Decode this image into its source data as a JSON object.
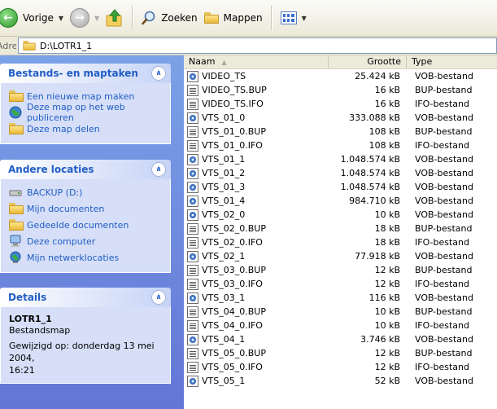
{
  "toolbar": {
    "back_label": "Vorige",
    "search_label": "Zoeken",
    "folders_label": "Mappen"
  },
  "address": {
    "label": "Adres",
    "path": "D:\\LOTR1_1"
  },
  "taskpane": {
    "file_tasks": {
      "title": "Bestands- en maptaken",
      "items": [
        "Een nieuwe map maken",
        "Deze map op het web publiceren",
        "Deze map delen"
      ]
    },
    "other_places": {
      "title": "Andere locaties",
      "items": [
        "BACKUP (D:)",
        "Mijn documenten",
        "Gedeelde documenten",
        "Deze computer",
        "Mijn netwerklocaties"
      ]
    },
    "details": {
      "title": "Details",
      "name": "LOTR1_1",
      "kind": "Bestandsmap",
      "modified_line1": "Gewijzigd op: donderdag 13 mei 2004,",
      "modified_line2": "16:21"
    }
  },
  "filelist": {
    "columns": {
      "name": "Naam",
      "size": "Grootte",
      "type": "Type"
    },
    "rows": [
      {
        "name": "VIDEO_TS",
        "size": "25.424 kB",
        "type": "VOB-bestand",
        "icon": "vob"
      },
      {
        "name": "VIDEO_TS.BUP",
        "size": "16 kB",
        "type": "BUP-bestand",
        "icon": "doc"
      },
      {
        "name": "VIDEO_TS.IFO",
        "size": "16 kB",
        "type": "IFO-bestand",
        "icon": "doc"
      },
      {
        "name": "VTS_01_0",
        "size": "333.088 kB",
        "type": "VOB-bestand",
        "icon": "vob"
      },
      {
        "name": "VTS_01_0.BUP",
        "size": "108 kB",
        "type": "BUP-bestand",
        "icon": "doc"
      },
      {
        "name": "VTS_01_0.IFO",
        "size": "108 kB",
        "type": "IFO-bestand",
        "icon": "doc"
      },
      {
        "name": "VTS_01_1",
        "size": "1.048.574 kB",
        "type": "VOB-bestand",
        "icon": "vob"
      },
      {
        "name": "VTS_01_2",
        "size": "1.048.574 kB",
        "type": "VOB-bestand",
        "icon": "vob"
      },
      {
        "name": "VTS_01_3",
        "size": "1.048.574 kB",
        "type": "VOB-bestand",
        "icon": "vob"
      },
      {
        "name": "VTS_01_4",
        "size": "984.710 kB",
        "type": "VOB-bestand",
        "icon": "vob"
      },
      {
        "name": "VTS_02_0",
        "size": "10 kB",
        "type": "VOB-bestand",
        "icon": "vob"
      },
      {
        "name": "VTS_02_0.BUP",
        "size": "18 kB",
        "type": "BUP-bestand",
        "icon": "doc"
      },
      {
        "name": "VTS_02_0.IFO",
        "size": "18 kB",
        "type": "IFO-bestand",
        "icon": "doc"
      },
      {
        "name": "VTS_02_1",
        "size": "77.918 kB",
        "type": "VOB-bestand",
        "icon": "vob"
      },
      {
        "name": "VTS_03_0.BUP",
        "size": "12 kB",
        "type": "BUP-bestand",
        "icon": "doc"
      },
      {
        "name": "VTS_03_0.IFO",
        "size": "12 kB",
        "type": "IFO-bestand",
        "icon": "doc"
      },
      {
        "name": "VTS_03_1",
        "size": "116 kB",
        "type": "VOB-bestand",
        "icon": "vob"
      },
      {
        "name": "VTS_04_0.BUP",
        "size": "10 kB",
        "type": "BUP-bestand",
        "icon": "doc"
      },
      {
        "name": "VTS_04_0.IFO",
        "size": "10 kB",
        "type": "IFO-bestand",
        "icon": "doc"
      },
      {
        "name": "VTS_04_1",
        "size": "3.746 kB",
        "type": "VOB-bestand",
        "icon": "vob"
      },
      {
        "name": "VTS_05_0.BUP",
        "size": "12 kB",
        "type": "BUP-bestand",
        "icon": "doc"
      },
      {
        "name": "VTS_05_0.IFO",
        "size": "12 kB",
        "type": "IFO-bestand",
        "icon": "doc"
      },
      {
        "name": "VTS_05_1",
        "size": "52 kB",
        "type": "VOB-bestand",
        "icon": "vob"
      }
    ]
  }
}
